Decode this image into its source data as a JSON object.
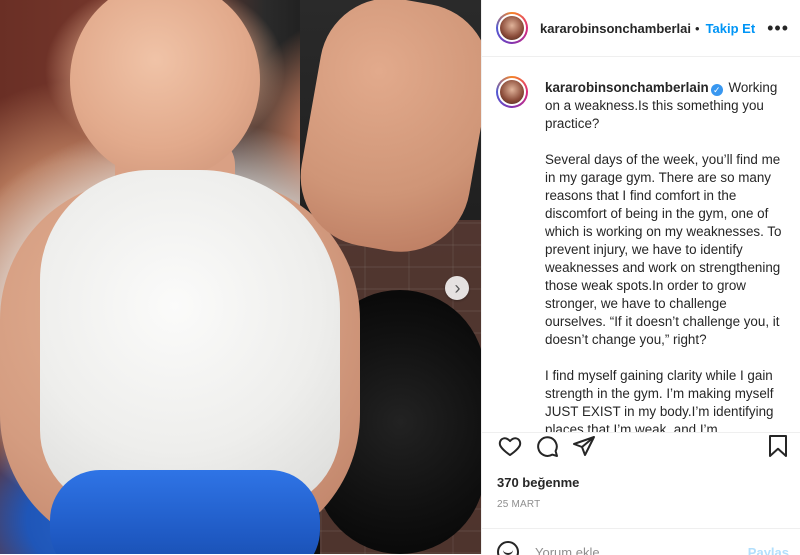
{
  "header": {
    "username": "kararobinsonchamberlai",
    "separator": "•",
    "follow_label": "Takip Et",
    "more_label": "•••"
  },
  "caption": {
    "username": "kararobinsonchamberlain",
    "verified_icon": "verified-badge-icon",
    "text": " Working on a weakness.Is this something you practice?\n\nSeveral days of the week, you’ll find me in my garage gym. There are so many reasons that I find comfort in the discomfort of being in the gym, one of which is working on my weaknesses. To prevent injury, we have to identify weaknesses and work on strengthening those weak spots.In order to grow stronger, we have to challenge ourselves. “If it doesn’t challenge you, it doesn’t change you,” right?\n\nI find myself gaining clarity while I gain strength in the gym. I’m making myself JUST EXIST in my body.I’m identifying places that I’m weak, and I’m"
  },
  "actions": {
    "like_icon": "heart-icon",
    "comment_icon": "comment-icon",
    "share_icon": "send-icon",
    "save_icon": "bookmark-icon"
  },
  "likes": "370 beğenme",
  "date": "25 MART",
  "comment": {
    "placeholder": "Yorum ekle...",
    "post_label": "Paylaş",
    "emoji_icon": "emoji-icon"
  },
  "colors": {
    "link": "#0095f6",
    "text": "#262626",
    "muted": "#8e8e8e",
    "verified": "#3897f0"
  }
}
